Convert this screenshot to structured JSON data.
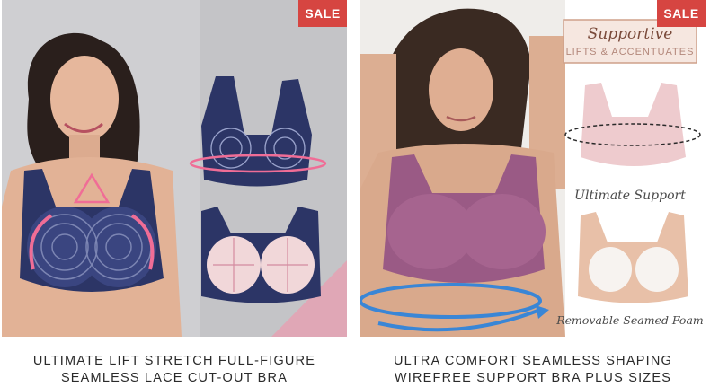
{
  "products": [
    {
      "badge": "SALE",
      "title_line1": "ULTIMATE LIFT STRETCH FULL-FIGURE",
      "title_line2": "SEAMLESS LACE CUT-OUT BRA"
    },
    {
      "badge": "SALE",
      "title_line1": "ULTRA COMFORT SEAMLESS SHAPING",
      "title_line2": "WIREFREE SUPPORT BRA PLUS SIZES",
      "image_text": {
        "brand": "Supportive",
        "tagline": "LIFTS & ACCENTUATES",
        "caption1": "Ultimate Support",
        "caption2": "Removable Seamed Foam"
      }
    }
  ],
  "colors": {
    "sale_badge": "#d64541",
    "navy_lace": "#2c3566",
    "mauve": "#9a5a85",
    "skin": "#e8c0a8"
  },
  "icons": [
    "sale-badge",
    "arrow-icon"
  ]
}
